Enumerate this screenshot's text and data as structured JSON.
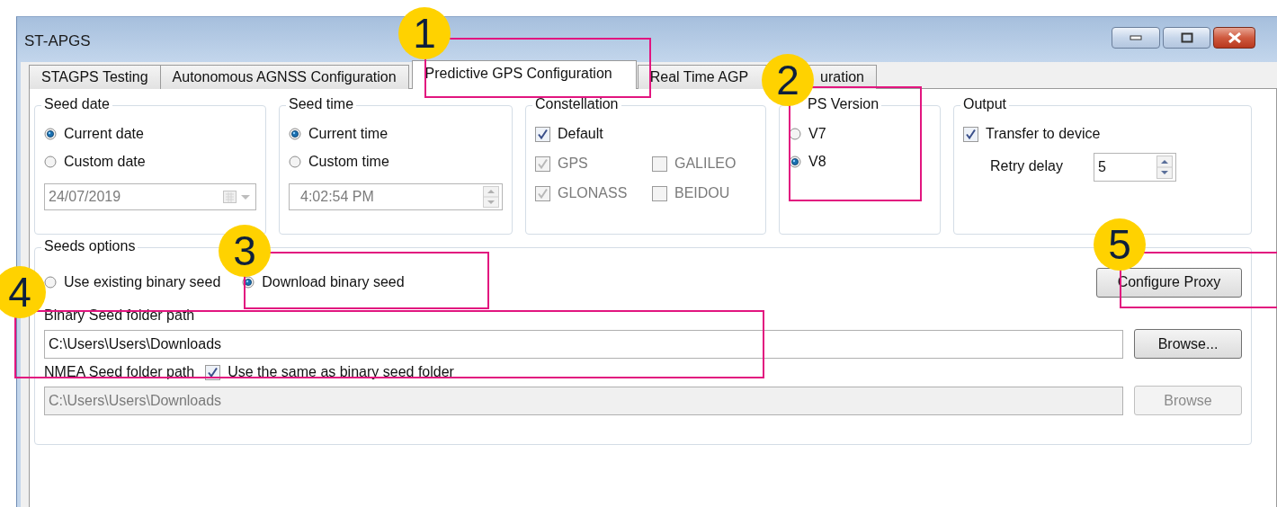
{
  "window": {
    "title": "ST-APGS"
  },
  "tabs": [
    {
      "label": "STAGPS Testing",
      "selected": false
    },
    {
      "label": "Autonomous AGNSS Configuration",
      "selected": false
    },
    {
      "label": "Predictive GPS Configuration",
      "selected": true
    },
    {
      "label": "Real Time AGP",
      "label_tail": "uration",
      "selected": false
    }
  ],
  "seed_date": {
    "title": "Seed date",
    "options": [
      {
        "label": "Current date",
        "selected": true
      },
      {
        "label": "Custom date",
        "selected": false
      }
    ],
    "date": {
      "value": "24/07/2019",
      "disabled": true
    }
  },
  "seed_time": {
    "title": "Seed time",
    "options": [
      {
        "label": "Current time",
        "selected": true
      },
      {
        "label": "Custom time",
        "selected": false
      }
    ],
    "time": {
      "value": "4:02:54 PM",
      "disabled": true
    }
  },
  "constellation": {
    "title": "Constellation",
    "items": [
      {
        "label": "Default",
        "checked": true,
        "disabled": false
      },
      {
        "label": "GPS",
        "checked": true,
        "disabled": true
      },
      {
        "label": "GALILEO",
        "checked": false,
        "disabled": true
      },
      {
        "label": "GLONASS",
        "checked": true,
        "disabled": true
      },
      {
        "label": "BEIDOU",
        "checked": false,
        "disabled": true
      }
    ]
  },
  "gps_version": {
    "title": "PS Version",
    "options": [
      {
        "label": "V7",
        "selected": false
      },
      {
        "label": "V8",
        "selected": true
      }
    ]
  },
  "output": {
    "title": "Output",
    "transfer": {
      "label": "Transfer to device",
      "checked": true
    },
    "retry_label": "Retry delay",
    "retry_value": "5"
  },
  "seeds_options": {
    "title": "Seeds options",
    "options": [
      {
        "label": "Use existing binary seed",
        "selected": false
      },
      {
        "label": "Download binary seed",
        "selected": true
      }
    ],
    "proxy_button": "Configure Proxy",
    "binary_label": "Binary Seed folder path",
    "binary_path": {
      "value": "C:\\Users\\Users\\Downloads",
      "disabled": false
    },
    "binary_browse": {
      "label": "Browse...",
      "disabled": false
    },
    "nmea_label": "NMEA Seed folder path",
    "same_folder": {
      "label": "Use the same as binary seed folder",
      "checked": true
    },
    "nmea_path": {
      "value": "C:\\Users\\Users\\Downloads",
      "disabled": true
    },
    "nmea_browse": {
      "label": "Browse",
      "disabled": true
    }
  },
  "annotations": [
    {
      "number": "1"
    },
    {
      "number": "2"
    },
    {
      "number": "3"
    },
    {
      "number": "4"
    },
    {
      "number": "5"
    }
  ]
}
